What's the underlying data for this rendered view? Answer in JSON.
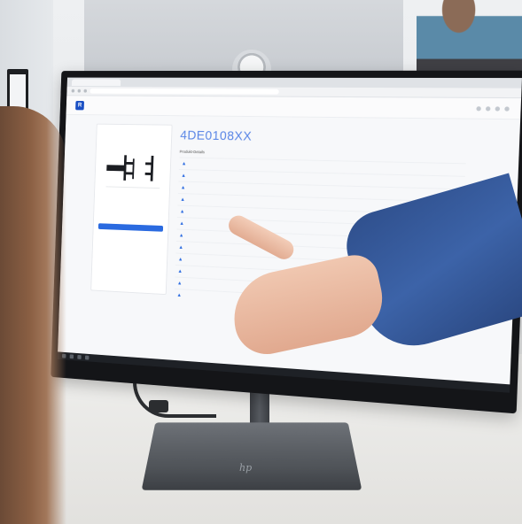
{
  "browser": {
    "tab_label": "",
    "url": ""
  },
  "app": {
    "logo_letter": "R",
    "breadcrumb_current": "",
    "breadcrumb_prefix": ""
  },
  "product": {
    "title": "4DE0108XX",
    "subtitle": "",
    "section_label": "Produkt-Details"
  },
  "card": {
    "title": "",
    "configure_label": ""
  },
  "table": {
    "rows": [
      [
        "",
        "",
        "",
        ""
      ],
      [
        "",
        "",
        "",
        ""
      ],
      [
        "",
        "",
        "",
        ""
      ],
      [
        "",
        "",
        "",
        ""
      ],
      [
        "",
        "",
        "",
        ""
      ],
      [
        "",
        "",
        "",
        ""
      ],
      [
        "",
        "",
        "",
        ""
      ],
      [
        "",
        "",
        "",
        ""
      ],
      [
        "",
        "",
        "",
        ""
      ],
      [
        "",
        "",
        "",
        ""
      ],
      [
        "",
        "",
        "",
        ""
      ],
      [
        "",
        "",
        "",
        ""
      ]
    ]
  },
  "monitor": {
    "brand_mark": "hp"
  }
}
